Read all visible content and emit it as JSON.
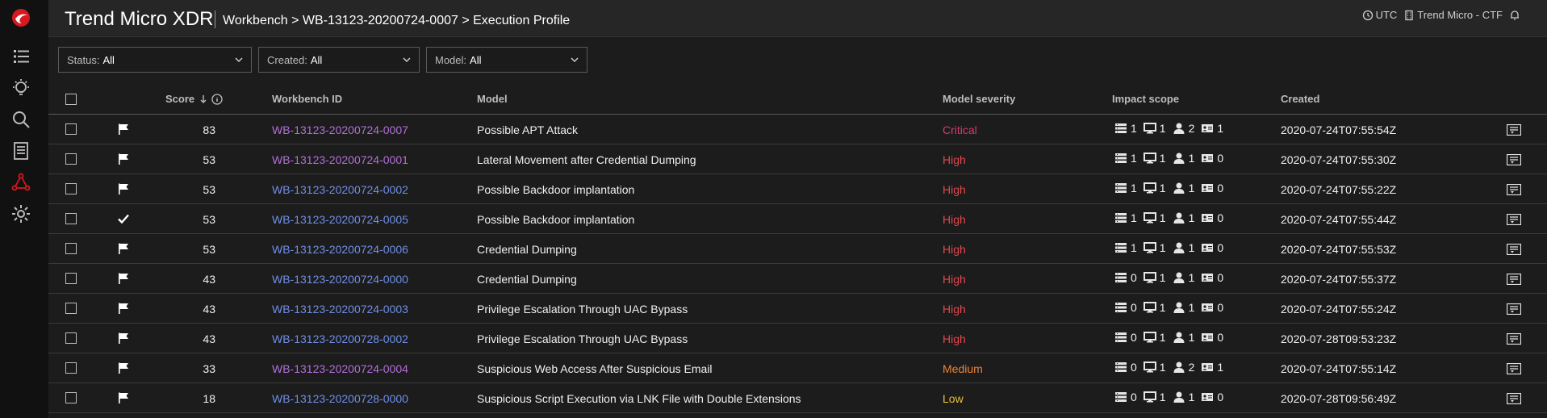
{
  "header": {
    "app_title": "Trend Micro XDR",
    "breadcrumb": "Workbench > WB-13123-20200724-0007 > Execution Profile",
    "timezone": "UTC",
    "tenant": "Trend Micro - CTF"
  },
  "sidebar": {
    "items": [
      {
        "icon": "trend-micro-logo-icon"
      },
      {
        "icon": "list-icon"
      },
      {
        "icon": "lightbulb-icon"
      },
      {
        "icon": "search-icon"
      },
      {
        "icon": "server-icon"
      },
      {
        "icon": "network-graph-icon"
      },
      {
        "icon": "gear-icon"
      }
    ]
  },
  "filters": [
    {
      "label": "Status:",
      "value": "All"
    },
    {
      "label": "Created:",
      "value": "All"
    },
    {
      "label": "Model:",
      "value": "All"
    }
  ],
  "table": {
    "columns": {
      "score": "Score",
      "workbench_id": "Workbench ID",
      "model": "Model",
      "severity": "Model severity",
      "impact": "Impact scope",
      "created": "Created"
    },
    "rows": [
      {
        "flag": "flag",
        "score": "83",
        "id": "WB-13123-20200724-0007",
        "visited": true,
        "model": "Possible APT Attack",
        "severity": "Critical",
        "sev": "critical",
        "servers": "1",
        "desktops": "1",
        "users": "2",
        "emails": "1",
        "created": "2020-07-24T07:55:54Z"
      },
      {
        "flag": "flag",
        "score": "53",
        "id": "WB-13123-20200724-0001",
        "visited": true,
        "model": "Lateral Movement after Credential Dumping",
        "severity": "High",
        "sev": "high",
        "servers": "1",
        "desktops": "1",
        "users": "1",
        "emails": "0",
        "created": "2020-07-24T07:55:30Z"
      },
      {
        "flag": "flag",
        "score": "53",
        "id": "WB-13123-20200724-0002",
        "visited": false,
        "model": "Possible Backdoor implantation",
        "severity": "High",
        "sev": "high",
        "servers": "1",
        "desktops": "1",
        "users": "1",
        "emails": "0",
        "created": "2020-07-24T07:55:22Z"
      },
      {
        "flag": "check",
        "score": "53",
        "id": "WB-13123-20200724-0005",
        "visited": false,
        "model": "Possible Backdoor implantation",
        "severity": "High",
        "sev": "high",
        "servers": "1",
        "desktops": "1",
        "users": "1",
        "emails": "0",
        "created": "2020-07-24T07:55:44Z"
      },
      {
        "flag": "flag",
        "score": "53",
        "id": "WB-13123-20200724-0006",
        "visited": false,
        "model": "Credential Dumping",
        "severity": "High",
        "sev": "high",
        "servers": "1",
        "desktops": "1",
        "users": "1",
        "emails": "0",
        "created": "2020-07-24T07:55:53Z"
      },
      {
        "flag": "flag",
        "score": "43",
        "id": "WB-13123-20200724-0000",
        "visited": false,
        "model": "Credential Dumping",
        "severity": "High",
        "sev": "high",
        "servers": "0",
        "desktops": "1",
        "users": "1",
        "emails": "0",
        "created": "2020-07-24T07:55:37Z"
      },
      {
        "flag": "flag",
        "score": "43",
        "id": "WB-13123-20200724-0003",
        "visited": false,
        "model": "Privilege Escalation Through UAC Bypass",
        "severity": "High",
        "sev": "high",
        "servers": "0",
        "desktops": "1",
        "users": "1",
        "emails": "0",
        "created": "2020-07-24T07:55:24Z"
      },
      {
        "flag": "flag",
        "score": "43",
        "id": "WB-13123-20200728-0002",
        "visited": false,
        "model": "Privilege Escalation Through UAC Bypass",
        "severity": "High",
        "sev": "high",
        "servers": "0",
        "desktops": "1",
        "users": "1",
        "emails": "0",
        "created": "2020-07-28T09:53:23Z"
      },
      {
        "flag": "flag",
        "score": "33",
        "id": "WB-13123-20200724-0004",
        "visited": true,
        "model": "Suspicious Web Access After Suspicious Email",
        "severity": "Medium",
        "sev": "medium",
        "servers": "0",
        "desktops": "1",
        "users": "2",
        "emails": "1",
        "created": "2020-07-24T07:55:14Z"
      },
      {
        "flag": "flag",
        "score": "18",
        "id": "WB-13123-20200728-0000",
        "visited": false,
        "model": "Suspicious Script Execution via LNK File with Double Extensions",
        "severity": "Low",
        "sev": "low",
        "servers": "0",
        "desktops": "1",
        "users": "1",
        "emails": "0",
        "created": "2020-07-28T09:56:49Z"
      }
    ]
  }
}
